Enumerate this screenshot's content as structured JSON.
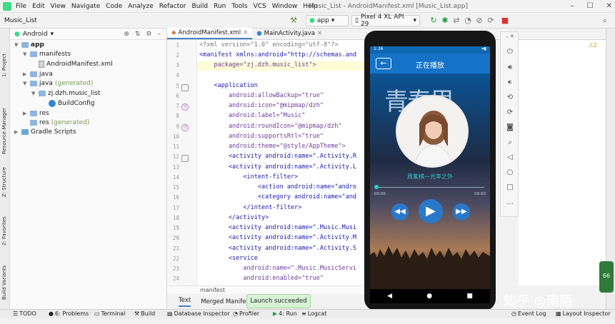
{
  "menu": [
    "File",
    "Edit",
    "View",
    "Navigate",
    "Code",
    "Analyze",
    "Refactor",
    "Build",
    "Run",
    "Tools",
    "VCS",
    "Window",
    "Help"
  ],
  "window_title": "Music_List - AndroidManifest.xml [Music_List.app]",
  "toolbar": {
    "project": "Music_List",
    "run_config": "app",
    "device": "Pixel 4 XL API 29"
  },
  "left_tools": [
    "1: Project",
    "Resource Manager",
    "Z: Structure",
    "2: Favorites",
    "Build Variants"
  ],
  "project_panel": {
    "view_mode": "Android",
    "tree": [
      {
        "label": "app",
        "depth": 0,
        "kind": "folder",
        "open": true
      },
      {
        "label": "manifests",
        "depth": 1,
        "kind": "folder",
        "open": true
      },
      {
        "label": "AndroidManifest.xml",
        "depth": 2,
        "kind": "file"
      },
      {
        "label": "java",
        "depth": 1,
        "kind": "folder",
        "open": false
      },
      {
        "label": "java",
        "suffix": "(generated)",
        "depth": 1,
        "kind": "folder",
        "open": true
      },
      {
        "label": "zj.dzh.music_list",
        "depth": 2,
        "kind": "folder",
        "open": true
      },
      {
        "label": "BuildConfig",
        "depth": 3,
        "kind": "class"
      },
      {
        "label": "res",
        "depth": 1,
        "kind": "folder",
        "open": false
      },
      {
        "label": "res",
        "suffix": "(generated)",
        "depth": 1,
        "kind": "folder"
      },
      {
        "label": "Gradle Scripts",
        "depth": 0,
        "kind": "folder",
        "open": false
      }
    ]
  },
  "editor": {
    "tabs": [
      {
        "label": "AndroidManifest.xml",
        "active": true
      },
      {
        "label": "MainActivity.java",
        "active": false
      }
    ],
    "line_numbers": [
      "1",
      "2",
      "3",
      "4",
      "5",
      "6",
      "7",
      "8",
      "9",
      "10",
      "11",
      "12",
      "13",
      "14",
      "15",
      "16",
      "17",
      "18",
      "19",
      "20",
      "21",
      "22",
      "23",
      "24"
    ],
    "code_lines": [
      "<?xml version=\"1.0\" encoding=\"utf-8\"?>",
      "<manifest xmlns:android=\"http://schemas.and",
      "    package=\"zj.dzh.music_list\">",
      "",
      "    <application",
      "        android:allowBackup=\"true\"",
      "        android:icon=\"@mipmap/dzh\"",
      "        android:label=\"Music\"",
      "        android:roundIcon=\"@mipmap/dzh\"",
      "        android:supportsRtl=\"true\"",
      "        android:theme=\"@style/AppTheme\">",
      "        <activity android:name=\".Activity.R",
      "        <activity android:name=\".Activity.L",
      "            <intent-filter>",
      "                <action android:name=\"andro",
      "                <category android:name=\"and",
      "            </intent-filter>",
      "        </activity>",
      "        <activity android:name=\".Music.Musi",
      "        <activity android:name=\".Activity.M",
      "        <activity android:name=\".Activity.S",
      "        <service",
      "            android:name=\".Music.MusicServi",
      "            android:enabled=\"true\""
    ],
    "warning_count": "2",
    "breadcrumb": "manifest",
    "bottom_tabs": [
      "Text",
      "Merged Manifest"
    ]
  },
  "toast": "Launch succeeded",
  "bottom_tools": [
    "TODO",
    "6: Problems",
    "Terminal",
    "Build",
    "Database Inspector",
    "Profiler",
    "4: Run",
    "Logcat"
  ],
  "bottom_tools_right": [
    "Event Log",
    "Layout Inspector"
  ],
  "phone": {
    "status_time": "1:36",
    "title": "正在播放",
    "background_text": "青春里",
    "song": "周紫棋—光年之外",
    "time_current": "00:00",
    "time_total": "00:00",
    "progress": 0
  },
  "emulator_controls": [
    "power-icon",
    "volume-up-icon",
    "volume-down-icon",
    "rotate-left-icon",
    "rotate-right-icon",
    "camera-icon",
    "zoom-icon",
    "back-icon",
    "home-icon",
    "overview-icon",
    "more-icon"
  ],
  "watermark": "知乎 @南陌",
  "floating_widget": "66"
}
